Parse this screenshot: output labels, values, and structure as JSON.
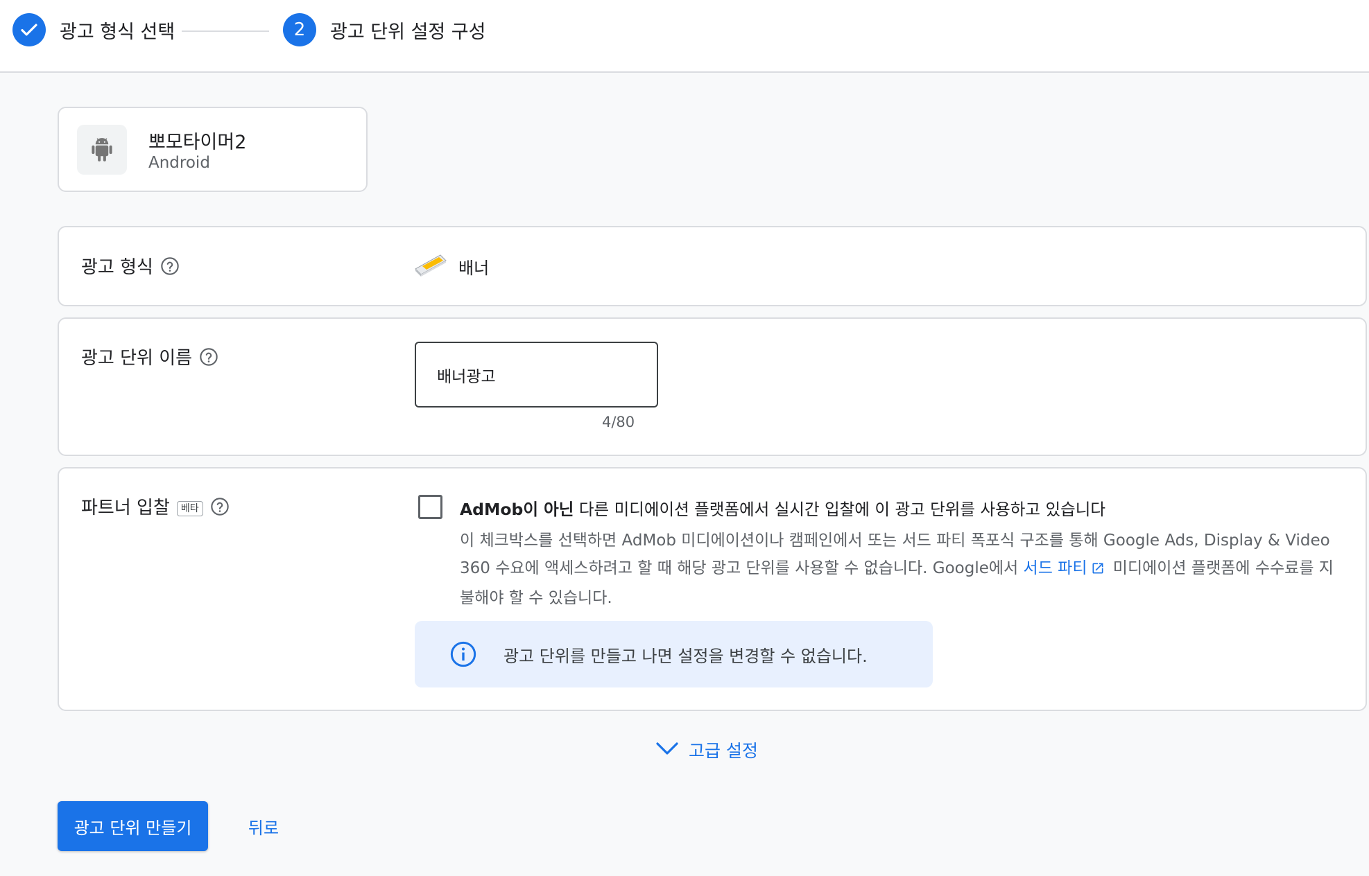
{
  "stepper": {
    "step1": {
      "label": "광고 형식 선택",
      "state": "completed"
    },
    "step2": {
      "number": "2",
      "label": "광고 단위 설정 구성",
      "state": "active"
    }
  },
  "app": {
    "name": "뽀모타이머2",
    "platform": "Android",
    "icon": "android-icon"
  },
  "ad_format": {
    "label": "광고 형식",
    "value": "배너",
    "icon": "banner-format-icon"
  },
  "ad_unit_name": {
    "label": "광고 단위 이름",
    "value": "배너광고",
    "char_count": "4/80"
  },
  "partner_bidding": {
    "label": "파트너 입찰",
    "badge": "베타",
    "checkbox_checked": false,
    "title_bold": "AdMob이 아닌",
    "title_rest": " 다른 미디에이션 플랫폼에서 실시간 입찰에 이 광고 단위를 사용하고 있습니다",
    "desc_part1": "이 체크박스를 선택하면 AdMob 미디에이션이나 캠페인에서 또는 서드 파티 폭포식 구조를 통해 Google Ads, Display & Video 360 수요에 액세스하려고 할 때 해당 광고 단위를 사용할 수 없습니다. Google에서 ",
    "desc_link": "서드 파티",
    "desc_part2": " 미디에이션 플랫폼에 수수료를 지불해야 할 수 있습니다.",
    "info_text": "광고 단위를 만들고 나면 설정을 변경할 수 없습니다."
  },
  "advanced_settings": {
    "label": "고급 설정"
  },
  "actions": {
    "create_label": "광고 단위 만들기",
    "back_label": "뒤로"
  },
  "colors": {
    "accent": "#1a73e8",
    "info_bg": "#e8f0fe",
    "border": "#dadce0",
    "page_bg": "#f8f9fa"
  }
}
